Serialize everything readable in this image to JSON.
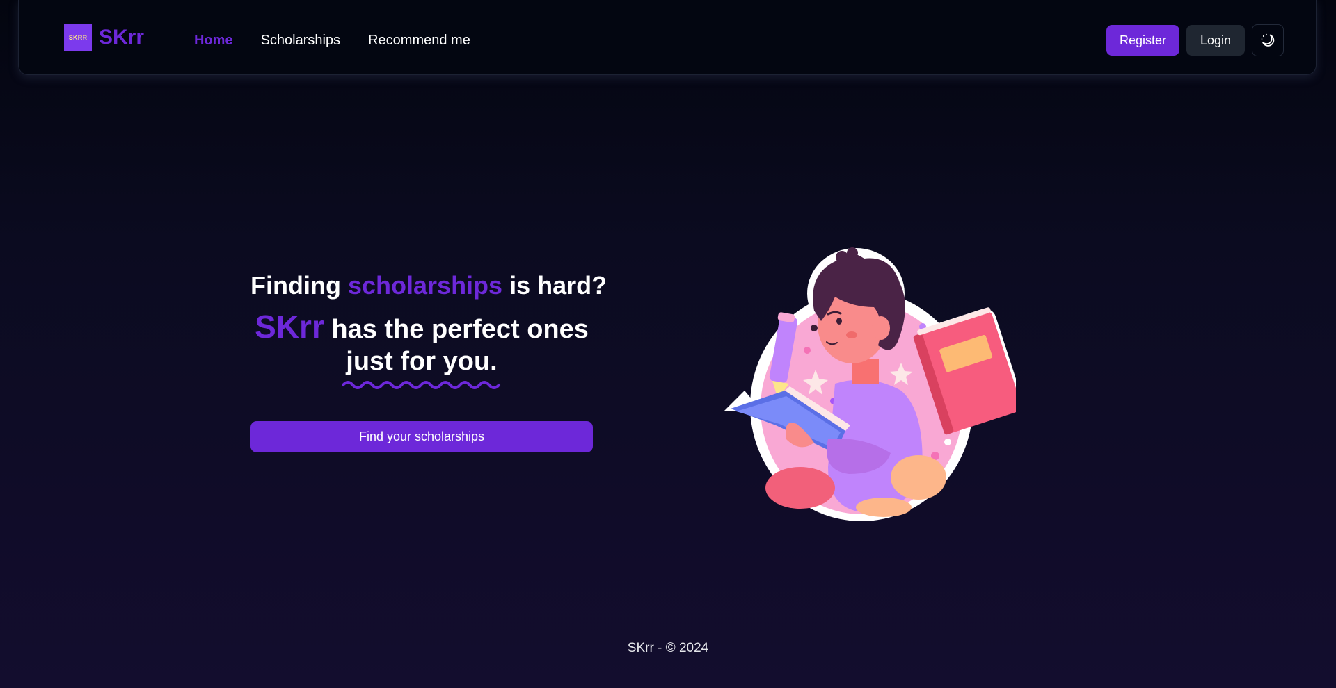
{
  "header": {
    "logo_badge": "SKRR",
    "brand": "SKrr",
    "nav": [
      {
        "label": "Home",
        "active": true
      },
      {
        "label": "Scholarships",
        "active": false
      },
      {
        "label": "Recommend me",
        "active": false
      }
    ],
    "register_label": "Register",
    "login_label": "Login",
    "theme_toggle_icon": "moon-stars-icon"
  },
  "hero": {
    "line1_pre": "Finding",
    "line1_accent": "scholarships",
    "line1_post": "is hard?",
    "line2_brand": "SKrr",
    "line2_rest": "has the perfect ones",
    "line3": "just for you.",
    "cta_label": "Find your scholarships",
    "illustration_icon": "child-reading-book-illustration"
  },
  "footer": {
    "text": "SKrr - © 2024"
  },
  "colors": {
    "accent": "#6d28d9",
    "background_top": "#03050f",
    "background_bottom": "#130d2e",
    "login_button": "#1f2631"
  }
}
